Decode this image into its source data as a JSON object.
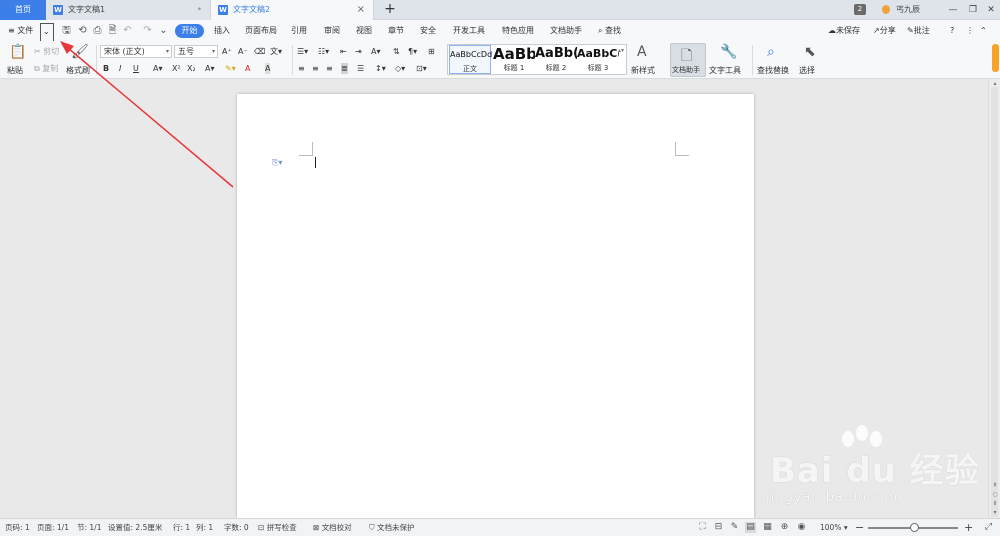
{
  "tabs": {
    "home": "首页",
    "doc1": "文字文稿1",
    "doc2": "文字文稿2",
    "new_tab": "+",
    "doc_icon": "W",
    "modified": "•",
    "close": "×"
  },
  "window": {
    "badge": "2",
    "user": "丐九辰",
    "minimize": "—",
    "restore": "❐",
    "close": "✕"
  },
  "menu": {
    "hamburger": "≡",
    "file": "文件",
    "start": "开始",
    "items": [
      "插入",
      "页面布局",
      "引用",
      "审阅",
      "视图",
      "章节",
      "安全",
      "开发工具",
      "特色应用",
      "文档助手"
    ],
    "search": "查找",
    "unsaved": "未保存",
    "share": "分享",
    "comment": "批注"
  },
  "ribbon": {
    "paste": "粘贴",
    "cut": "剪切",
    "copy": "复制",
    "format_painter": "格式刷",
    "font_name": "宋体 (正文)",
    "font_size": "五号",
    "bold": "B",
    "italic": "I",
    "underline": "U",
    "font_color": "A",
    "styles": [
      {
        "preview": "AaBbCcDd",
        "name": "正文"
      },
      {
        "preview": "AaBb",
        "name": "标题 1"
      },
      {
        "preview": "AaBb(",
        "name": "标题 2"
      },
      {
        "preview": "AaBbC(",
        "name": "标题 3"
      }
    ],
    "new_style": "新样式",
    "doc_assistant": "文档助手",
    "text_tools": "文字工具",
    "find_replace": "查找替换",
    "select": "选择"
  },
  "status": {
    "page_num": "页码: 1",
    "pages": "页面: 1/1",
    "section": "节: 1/1",
    "setting": "设置值: 2.5厘米",
    "row": "行: 1",
    "col": "列: 1",
    "words": "字数: 0",
    "spell": "拼写检查",
    "proof": "文档校对",
    "protect": "文档未保护",
    "zoom": "100%",
    "zoom_minus": "−",
    "zoom_plus": "+"
  },
  "watermark": {
    "logo": "Bai du 经验",
    "url": "jingyan.baidu.com"
  },
  "colors": {
    "accent": "#3d7fe8",
    "arrow": "#e8363a"
  }
}
